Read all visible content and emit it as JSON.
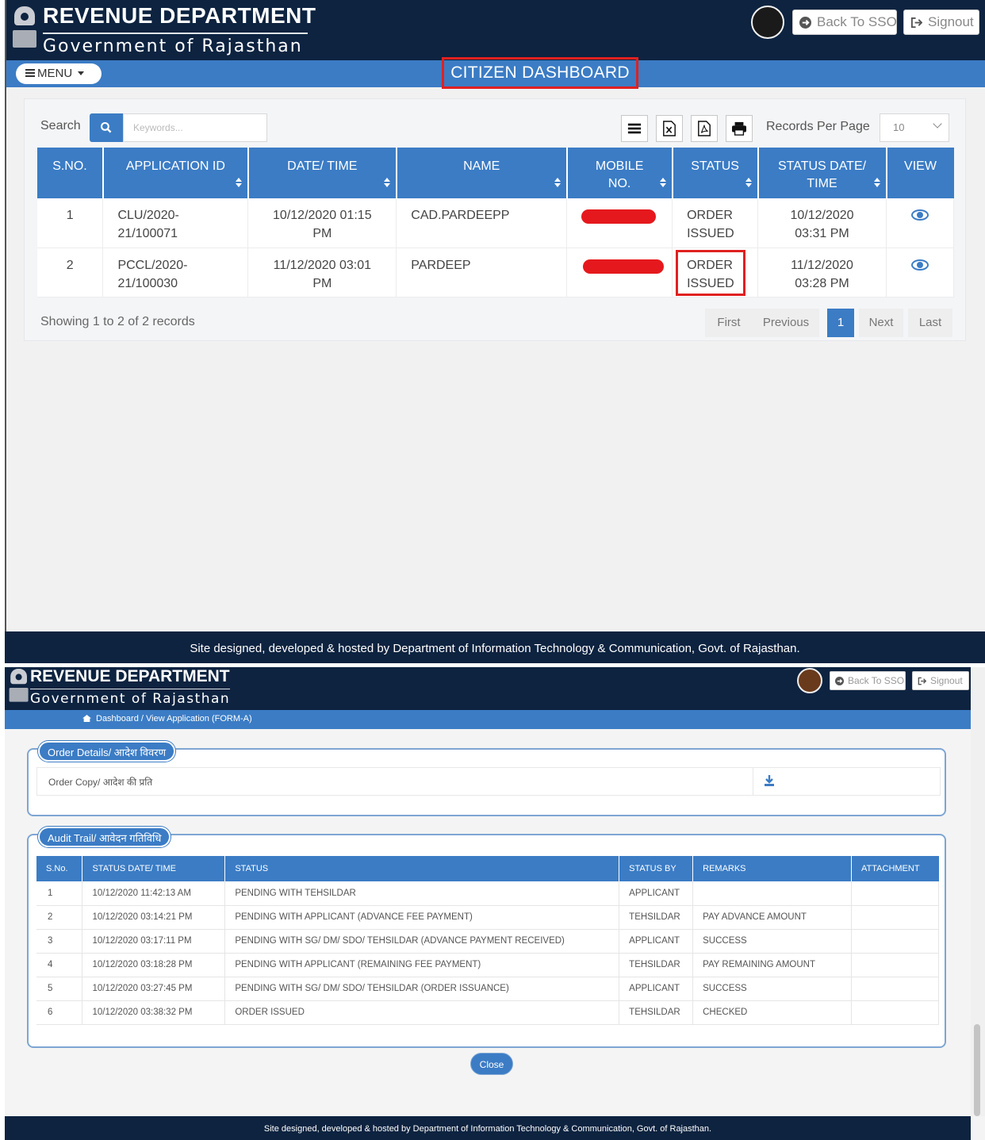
{
  "header": {
    "dept": "REVENUE DEPARTMENT",
    "gov": "Government of Rajasthan",
    "back_sso": "Back To SSO",
    "signout": "Signout"
  },
  "dashboard": {
    "menu_label": "MENU",
    "title": "CITIZEN DASHBOARD",
    "search_label": "Search",
    "search_placeholder": "Keywords...",
    "records_per_page_label": "Records Per Page",
    "records_per_page_value": "10",
    "table": {
      "headers": [
        "S.NO.",
        "APPLICATION ID",
        "DATE/ TIME",
        "NAME",
        "MOBILE NO.",
        "STATUS",
        "STATUS DATE/ TIME",
        "VIEW"
      ],
      "rows": [
        {
          "sno": "1",
          "app_id": "CLU/2020-21/100071",
          "datetime": "10/12/2020 01:15 PM",
          "name": "CAD.PARDEEPP",
          "status": "ORDER ISSUED",
          "status_datetime": "10/12/2020 03:31 PM"
        },
        {
          "sno": "2",
          "app_id": "PCCL/2020-21/100030",
          "datetime": "11/12/2020 03:01 PM",
          "name": "PARDEEP",
          "status": "ORDER ISSUED",
          "status_datetime": "11/12/2020 03:28 PM"
        }
      ]
    },
    "showing": "Showing 1 to 2 of 2 records",
    "pager": {
      "first": "First",
      "previous": "Previous",
      "current": "1",
      "next": "Next",
      "last": "Last"
    },
    "footer": "Site designed, developed & hosted by Department of Information Technology & Communication, Govt. of Rajasthan."
  },
  "view": {
    "breadcrumb": {
      "dashboard": "Dashboard",
      "sep": "/",
      "current": "View Application (FORM-A)"
    },
    "order_legend": "Order Details/ आदेश विवरण",
    "order_copy_label": "Order Copy/ आदेश की प्रति",
    "audit_legend": "Audit Trail/ आवेदन गतिविधि",
    "audit_headers": [
      "S.No.",
      "STATUS DATE/ TIME",
      "STATUS",
      "STATUS BY",
      "REMARKS",
      "ATTACHMENT"
    ],
    "audit_rows": [
      {
        "sno": "1",
        "datetime": "10/12/2020 11:42:13 AM",
        "status": "PENDING WITH TEHSILDAR",
        "by": "APPLICANT",
        "remarks": ""
      },
      {
        "sno": "2",
        "datetime": "10/12/2020 03:14:21 PM",
        "status": "PENDING WITH APPLICANT (ADVANCE FEE PAYMENT)",
        "by": "TEHSILDAR",
        "remarks": "PAY ADVANCE AMOUNT"
      },
      {
        "sno": "3",
        "datetime": "10/12/2020 03:17:11 PM",
        "status": "PENDING WITH SG/ DM/ SDO/ TEHSILDAR (ADVANCE PAYMENT RECEIVED)",
        "by": "APPLICANT",
        "remarks": "SUCCESS"
      },
      {
        "sno": "4",
        "datetime": "10/12/2020 03:18:28 PM",
        "status": "PENDING WITH APPLICANT (REMAINING FEE PAYMENT)",
        "by": "TEHSILDAR",
        "remarks": "PAY REMAINING AMOUNT"
      },
      {
        "sno": "5",
        "datetime": "10/12/2020 03:27:45 PM",
        "status": "PENDING WITH SG/ DM/ SDO/ TEHSILDAR (ORDER ISSUANCE)",
        "by": "APPLICANT",
        "remarks": "SUCCESS"
      },
      {
        "sno": "6",
        "datetime": "10/12/2020 03:38:32 PM",
        "status": "ORDER ISSUED",
        "by": "TEHSILDAR",
        "remarks": "CHECKED"
      }
    ],
    "close": "Close",
    "footer": "Site designed, developed & hosted by Department of Information Technology & Communication, Govt. of Rajasthan."
  },
  "colors": {
    "navy": "#0d2340",
    "blue": "#3b7cc5",
    "highlight_red": "#e02020",
    "redaction": "#e5191d"
  }
}
